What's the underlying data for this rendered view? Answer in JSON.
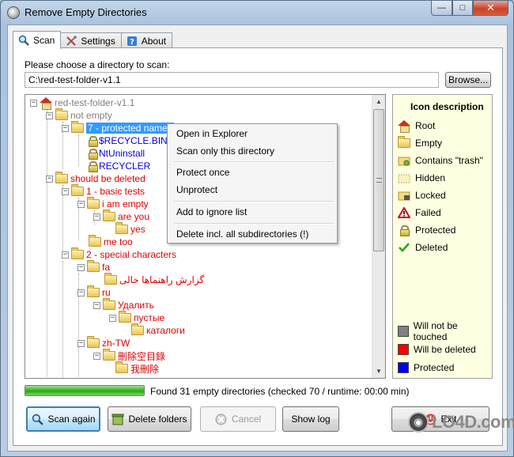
{
  "window": {
    "title": "Remove Empty Directories"
  },
  "tabs": [
    {
      "label": "Scan",
      "icon": "magnifier-icon",
      "active": true
    },
    {
      "label": "Settings",
      "icon": "tools-icon",
      "active": false
    },
    {
      "label": "About",
      "icon": "help-icon",
      "active": false
    }
  ],
  "scan": {
    "prompt": "Please choose a directory to scan:",
    "path_value": "C:\\red-test-folder-v1.1",
    "browse_label": "Browse..."
  },
  "tree": {
    "root": "red-test-folder-v1.1",
    "items": {
      "not_empty": "not empty",
      "protected_names": "7 - protected names",
      "recycle_bin": "$RECYCLE.BIN",
      "ntuninstall": "NtUninstall",
      "recycler": "RECYCLER",
      "should_be_deleted": "should be deleted",
      "basic_tests": "1 - basic tests",
      "i_am_empty": "i am empty",
      "are_you": "are you",
      "yes": "yes",
      "me_too": "me too",
      "special_characters": "2 - special characters",
      "fa": "fa",
      "fa_child": "گزارش راهنماها خالی",
      "ru": "ru",
      "ru_child": "Удалить",
      "ru_grandchild": "пустые",
      "ru_greatgrandchild": "каталоги",
      "zh": "zh-TW",
      "zh_child": "刪除空目錄",
      "zh_grandchild": "我刪除"
    }
  },
  "context_menu": {
    "open_explorer": "Open in Explorer",
    "scan_only": "Scan only this directory",
    "protect_once": "Protect once",
    "unprotect": "Unprotect",
    "add_ignore": "Add to ignore list",
    "delete_all": "Delete incl. all subdirectories (!)"
  },
  "legend": {
    "header": "Icon description",
    "root": "Root",
    "empty": "Empty",
    "trash": "Contains \"trash\"",
    "hidden": "Hidden",
    "locked": "Locked",
    "failed": "Failed",
    "protected": "Protected",
    "deleted": "Deleted",
    "untouched": "Will not be touched",
    "will_delete": "Will be deleted",
    "protected_color": "Protected",
    "colors": {
      "untouched": "#808080",
      "will_delete": "#ff0000",
      "protected": "#0000ff"
    }
  },
  "status": {
    "progress": 1.0,
    "text": "Found 31 empty directories (checked 70 / runtime: 00:00 min)"
  },
  "buttons": {
    "scan_again": "Scan again",
    "delete_folders": "Delete folders",
    "cancel": "Cancel",
    "show_log": "Show log",
    "exit": "Exit"
  },
  "watermark": {
    "logo": "LO4D",
    "text": "LO4D.com"
  }
}
